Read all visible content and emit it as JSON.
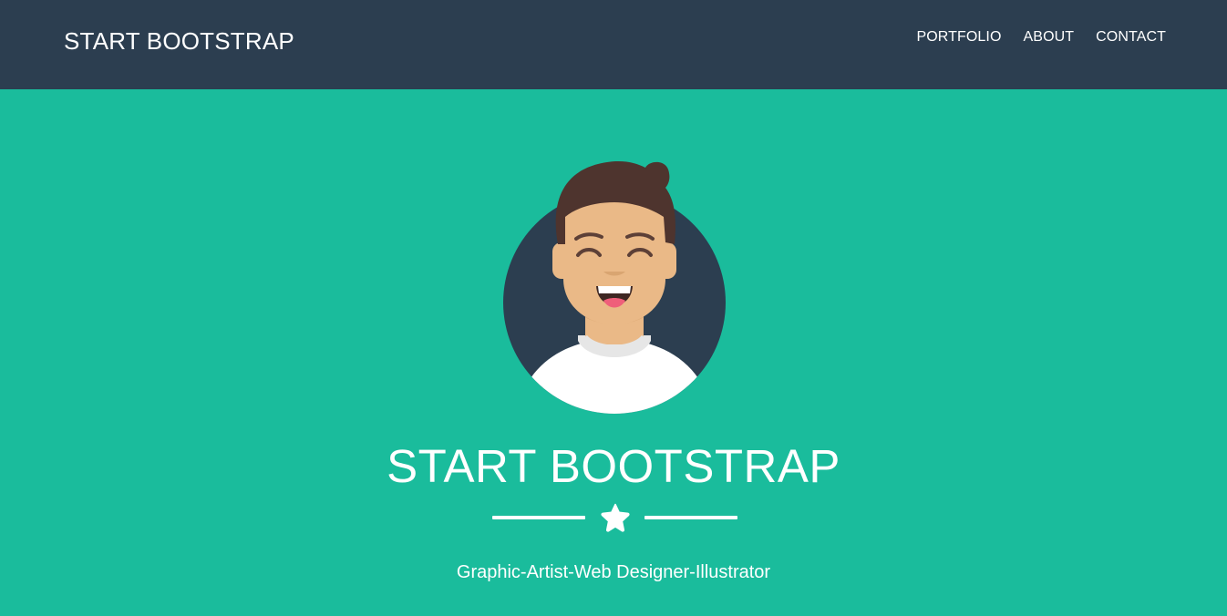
{
  "navbar": {
    "brand": "START BOOTSTRAP",
    "links": [
      "PORTFOLIO",
      "ABOUT",
      "CONTACT"
    ]
  },
  "masthead": {
    "avatar_icon": "smiling-person-avatar-icon",
    "title": "START BOOTSTRAP",
    "divider_icon": "star-icon",
    "subtitle": "Graphic-Artist-Web Designer-Illustrator"
  },
  "colors": {
    "navbar_bg": "#2c3e50",
    "masthead_bg": "#1abc9c",
    "text": "#ffffff"
  }
}
